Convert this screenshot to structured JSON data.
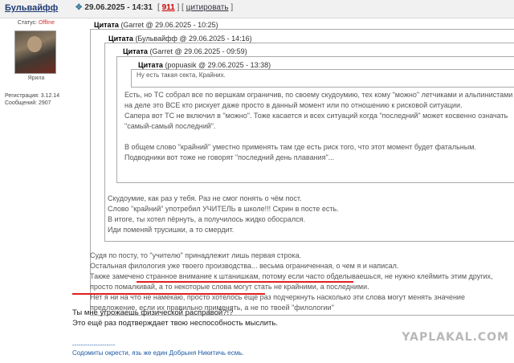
{
  "header": {
    "author": "Бульвайфф",
    "datetime": "29.06.2025 - 14:31",
    "post_number": "911",
    "cite_label": "цитировать"
  },
  "user": {
    "status_label": "Статус:",
    "status_value": "Offline",
    "rank": "Ярила",
    "registration": "Регистрация: 3.12.14",
    "messages": "Сообщений: 2907"
  },
  "quotes": {
    "q1_title": "Цитата",
    "q1_meta": " (Garret @ 29.06.2025 - 10:25)",
    "q2_title": "Цитата",
    "q2_meta": " (Бульвайфф @ 29.06.2025 - 14:16)",
    "q3_title": "Цитата",
    "q3_meta": " (Garret @ 29.06.2025 - 09:59)",
    "q4_title": "Цитата",
    "q4_meta": " (popuasik @ 29.06.2025 - 13:38)",
    "q4_text": "Ну есть такая секта, Крайних.",
    "q3_lines": [
      "Есть, но ТС собрал все по вершкам ограничив, по своему скудоумию, тех кому \"можно\" летчиками и альпинистами",
      "на деле это ВСЕ кто рискует даже просто в данный момент или по отношению к рисковой ситуации.",
      "Сапера вот ТС не включил в \"можно\". Тоже касается и всех ситуаций когда \"последний\" может косвенно означать",
      "\"самый-самый последний\".",
      "",
      "В общем слово \"крайний\" уместно применять там где есть риск того, что этот момент будет фатальным.",
      "Подводники вот тоже не говорят \"последний день плавания\"..."
    ],
    "q2_lines": [
      "Скудоумие, как раз у тебя. Раз не смог понять о чём пост.",
      "Слово \"крайний\" употребил УЧИТЕЛЬ в школе!!! Скрин в посте есть.",
      "В итоге, ты хотел пёрнуть, а получилось жидко обосрался.",
      "Иди поменяй трусишки, а то смердит."
    ],
    "q1_lines": [
      "Судя по посту, то \"учителю\" принадлежит лишь первая строка.",
      "Остальная филология уже твоего производства... весьма ограниченная, о чем я и написал.",
      "Также замечено странное внимание к штанишкам, потому если часто обделываешься, не нужно клеймить этим других,",
      "просто помалкивай, а то некоторые слова могут стать не крайними, а последними.",
      "Нет я ни на что не намекаю, просто хотелось еще раз подчеркнуть насколько эти слова могут менять значение",
      "предложение, если их правильно применять, а не по твоей \"филологии\""
    ]
  },
  "reply_lines": [
    "Ты мне угрожаешь физической расправой?!?",
    "Это ещё раз подтверждает твою неспособность мыслить."
  ],
  "signature": {
    "divider": "--------------------",
    "text": "Содомиты окрести, язь же един Добрыня Никитичь есмь."
  },
  "watermark": "YAPLAKAL.COM",
  "colors": {
    "underline": "#e02020",
    "status_offline": "#cc3333",
    "post_number": "#cc0000"
  }
}
